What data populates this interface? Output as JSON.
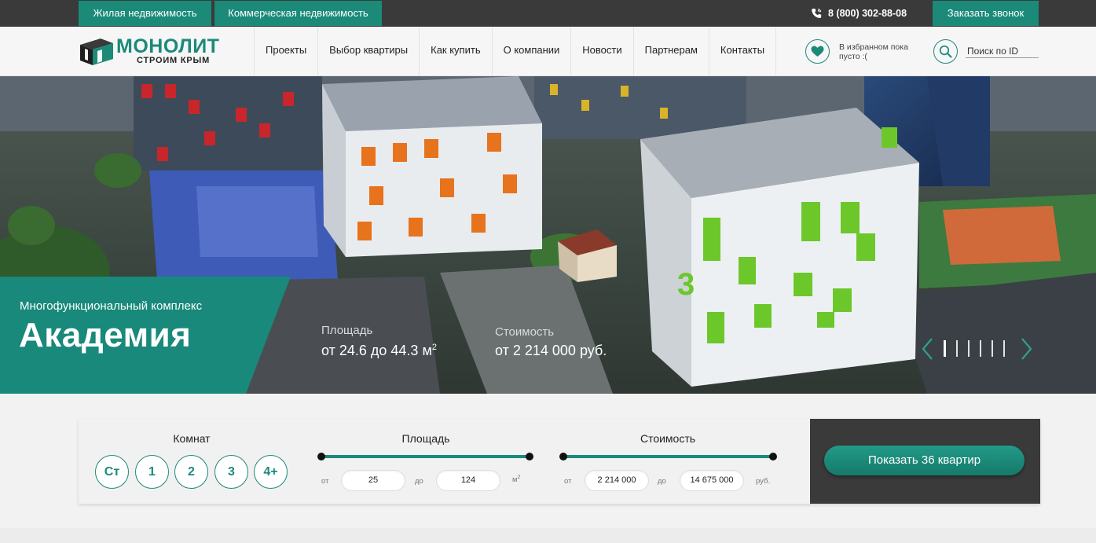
{
  "topbar": {
    "tab_residential": "Жилая недвижимость",
    "tab_commercial": "Коммерческая недвижимость",
    "phone": "8 (800) 302-88-08",
    "callback": "Заказать звонок"
  },
  "brand": {
    "name": "МОНОЛИТ",
    "tagline": "СТРОИМ КРЫМ",
    "accent": "#1b8a79",
    "dark": "#3a3a3a"
  },
  "nav": {
    "items": [
      {
        "label": "Проекты"
      },
      {
        "label": "Выбор квартиры"
      },
      {
        "label": "Как купить"
      },
      {
        "label": "О компании"
      },
      {
        "label": "Новости"
      },
      {
        "label": "Партнерам"
      },
      {
        "label": "Контакты"
      }
    ]
  },
  "favorites": {
    "icon": "heart-icon",
    "text": "В избранном пока пусто :("
  },
  "search": {
    "icon": "search-icon",
    "placeholder": "Поиск по ID"
  },
  "hero": {
    "subtitle": "Многофункциональный комплекс",
    "title": "Академия",
    "area_label": "Площадь",
    "area_value": "от 24.6 до 44.3 м",
    "area_unit_sup": "2",
    "price_label": "Стоимость",
    "price_value": "от 2 214 000 руб.",
    "slider": {
      "slide_count": 6,
      "active_index": 0
    }
  },
  "filter": {
    "rooms_label": "Комнат",
    "rooms": [
      "Ст",
      "1",
      "2",
      "3",
      "4+"
    ],
    "area_label": "Площадь",
    "area_from_label": "от",
    "area_from": "25",
    "area_to_label": "до",
    "area_to": "124",
    "area_unit": "м",
    "area_unit_sup": "2",
    "price_label": "Стоимость",
    "price_from_label": "от",
    "price_from": "2 214 000",
    "price_to_label": "до",
    "price_to": "14 675 000",
    "price_unit": "руб.",
    "submit": "Показать 36 квартир"
  }
}
